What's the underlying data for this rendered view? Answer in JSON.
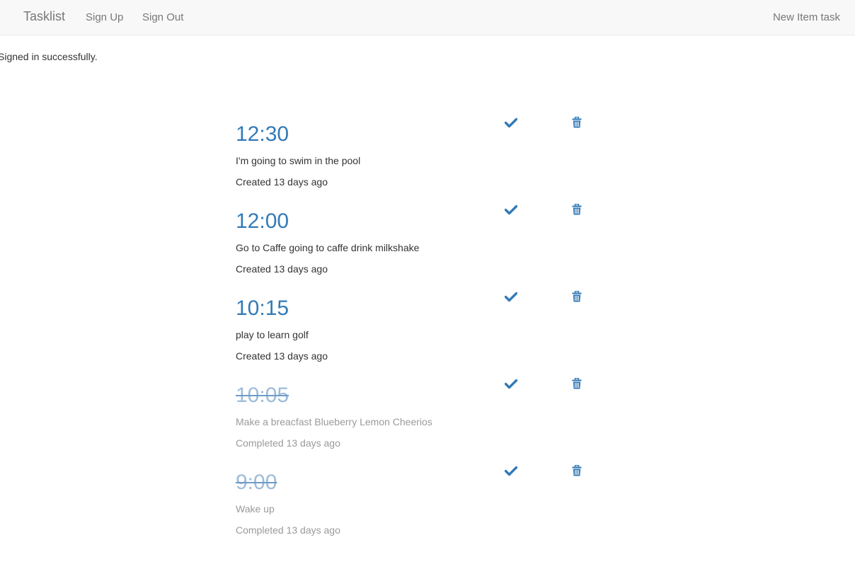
{
  "navbar": {
    "brand": "Tasklist",
    "sign_up": "Sign Up",
    "sign_out": "Sign Out",
    "new_item": "New Item task"
  },
  "flash": {
    "notice": "Signed in successfully."
  },
  "icons": {
    "complete": "check-icon",
    "delete": "trash-icon"
  },
  "colors": {
    "accent": "#337ab7",
    "completed_time": "#9dbcd9",
    "completed_text": "#9a9a9a"
  },
  "tasks": [
    {
      "time": "12:30",
      "title": "I'm going to swim in the pool",
      "status": "Created 13 days ago",
      "completed": false
    },
    {
      "time": "12:00",
      "title": "Go to Caffe going to caffe drink milkshake",
      "status": "Created 13 days ago",
      "completed": false
    },
    {
      "time": "10:15",
      "title": "play to learn golf",
      "status": "Created 13 days ago",
      "completed": false
    },
    {
      "time": "10:05",
      "title": "Make a breacfast Blueberry Lemon Cheerios",
      "status": "Completed 13 days ago",
      "completed": true
    },
    {
      "time": "9:00",
      "title": "Wake up",
      "status": "Completed 13 days ago",
      "completed": true
    }
  ]
}
